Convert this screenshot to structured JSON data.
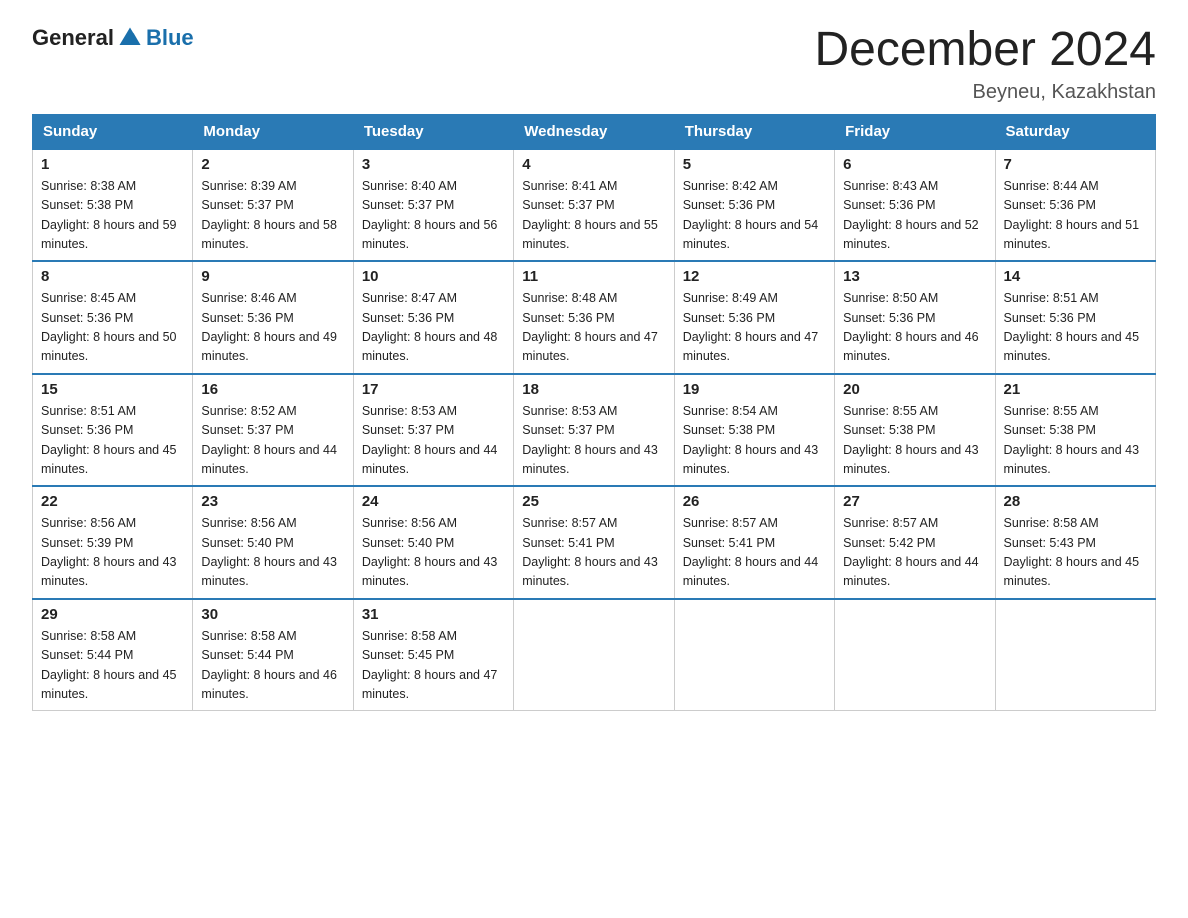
{
  "header": {
    "logo_general": "General",
    "logo_blue": "Blue",
    "month_title": "December 2024",
    "location": "Beyneu, Kazakhstan"
  },
  "days_of_week": [
    "Sunday",
    "Monday",
    "Tuesday",
    "Wednesday",
    "Thursday",
    "Friday",
    "Saturday"
  ],
  "weeks": [
    [
      {
        "day": "1",
        "sunrise": "8:38 AM",
        "sunset": "5:38 PM",
        "daylight": "8 hours and 59 minutes."
      },
      {
        "day": "2",
        "sunrise": "8:39 AM",
        "sunset": "5:37 PM",
        "daylight": "8 hours and 58 minutes."
      },
      {
        "day": "3",
        "sunrise": "8:40 AM",
        "sunset": "5:37 PM",
        "daylight": "8 hours and 56 minutes."
      },
      {
        "day": "4",
        "sunrise": "8:41 AM",
        "sunset": "5:37 PM",
        "daylight": "8 hours and 55 minutes."
      },
      {
        "day": "5",
        "sunrise": "8:42 AM",
        "sunset": "5:36 PM",
        "daylight": "8 hours and 54 minutes."
      },
      {
        "day": "6",
        "sunrise": "8:43 AM",
        "sunset": "5:36 PM",
        "daylight": "8 hours and 52 minutes."
      },
      {
        "day": "7",
        "sunrise": "8:44 AM",
        "sunset": "5:36 PM",
        "daylight": "8 hours and 51 minutes."
      }
    ],
    [
      {
        "day": "8",
        "sunrise": "8:45 AM",
        "sunset": "5:36 PM",
        "daylight": "8 hours and 50 minutes."
      },
      {
        "day": "9",
        "sunrise": "8:46 AM",
        "sunset": "5:36 PM",
        "daylight": "8 hours and 49 minutes."
      },
      {
        "day": "10",
        "sunrise": "8:47 AM",
        "sunset": "5:36 PM",
        "daylight": "8 hours and 48 minutes."
      },
      {
        "day": "11",
        "sunrise": "8:48 AM",
        "sunset": "5:36 PM",
        "daylight": "8 hours and 47 minutes."
      },
      {
        "day": "12",
        "sunrise": "8:49 AM",
        "sunset": "5:36 PM",
        "daylight": "8 hours and 47 minutes."
      },
      {
        "day": "13",
        "sunrise": "8:50 AM",
        "sunset": "5:36 PM",
        "daylight": "8 hours and 46 minutes."
      },
      {
        "day": "14",
        "sunrise": "8:51 AM",
        "sunset": "5:36 PM",
        "daylight": "8 hours and 45 minutes."
      }
    ],
    [
      {
        "day": "15",
        "sunrise": "8:51 AM",
        "sunset": "5:36 PM",
        "daylight": "8 hours and 45 minutes."
      },
      {
        "day": "16",
        "sunrise": "8:52 AM",
        "sunset": "5:37 PM",
        "daylight": "8 hours and 44 minutes."
      },
      {
        "day": "17",
        "sunrise": "8:53 AM",
        "sunset": "5:37 PM",
        "daylight": "8 hours and 44 minutes."
      },
      {
        "day": "18",
        "sunrise": "8:53 AM",
        "sunset": "5:37 PM",
        "daylight": "8 hours and 43 minutes."
      },
      {
        "day": "19",
        "sunrise": "8:54 AM",
        "sunset": "5:38 PM",
        "daylight": "8 hours and 43 minutes."
      },
      {
        "day": "20",
        "sunrise": "8:55 AM",
        "sunset": "5:38 PM",
        "daylight": "8 hours and 43 minutes."
      },
      {
        "day": "21",
        "sunrise": "8:55 AM",
        "sunset": "5:38 PM",
        "daylight": "8 hours and 43 minutes."
      }
    ],
    [
      {
        "day": "22",
        "sunrise": "8:56 AM",
        "sunset": "5:39 PM",
        "daylight": "8 hours and 43 minutes."
      },
      {
        "day": "23",
        "sunrise": "8:56 AM",
        "sunset": "5:40 PM",
        "daylight": "8 hours and 43 minutes."
      },
      {
        "day": "24",
        "sunrise": "8:56 AM",
        "sunset": "5:40 PM",
        "daylight": "8 hours and 43 minutes."
      },
      {
        "day": "25",
        "sunrise": "8:57 AM",
        "sunset": "5:41 PM",
        "daylight": "8 hours and 43 minutes."
      },
      {
        "day": "26",
        "sunrise": "8:57 AM",
        "sunset": "5:41 PM",
        "daylight": "8 hours and 44 minutes."
      },
      {
        "day": "27",
        "sunrise": "8:57 AM",
        "sunset": "5:42 PM",
        "daylight": "8 hours and 44 minutes."
      },
      {
        "day": "28",
        "sunrise": "8:58 AM",
        "sunset": "5:43 PM",
        "daylight": "8 hours and 45 minutes."
      }
    ],
    [
      {
        "day": "29",
        "sunrise": "8:58 AM",
        "sunset": "5:44 PM",
        "daylight": "8 hours and 45 minutes."
      },
      {
        "day": "30",
        "sunrise": "8:58 AM",
        "sunset": "5:44 PM",
        "daylight": "8 hours and 46 minutes."
      },
      {
        "day": "31",
        "sunrise": "8:58 AM",
        "sunset": "5:45 PM",
        "daylight": "8 hours and 47 minutes."
      },
      null,
      null,
      null,
      null
    ]
  ],
  "labels": {
    "sunrise": "Sunrise:",
    "sunset": "Sunset:",
    "daylight": "Daylight:"
  }
}
